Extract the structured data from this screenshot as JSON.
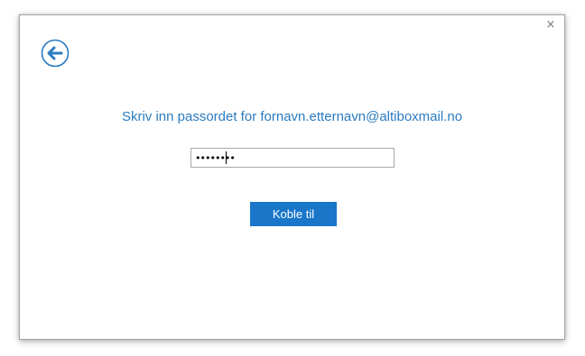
{
  "dialog": {
    "close_glyph": "×",
    "back_icon": "back-arrow-icon",
    "prompt": "Skriv inn passordet for fornavn.etternavn@altiboxmail.no",
    "password": {
      "value": "••••••••"
    },
    "connect_label": "Koble til"
  },
  "colors": {
    "accent": "#2b7bc0",
    "button": "#1976c9"
  }
}
